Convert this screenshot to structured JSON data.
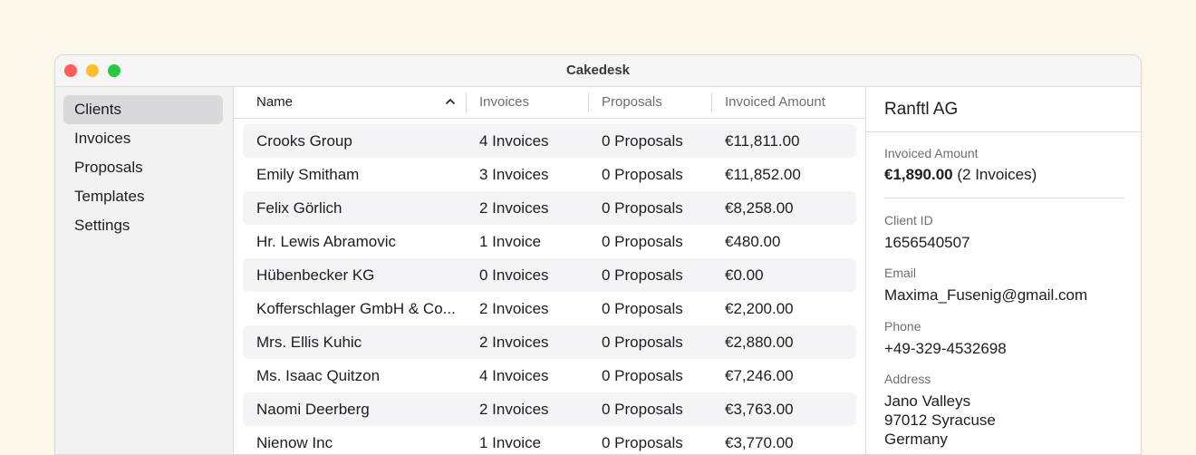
{
  "window": {
    "title": "Cakedesk"
  },
  "sidebar": {
    "items": [
      {
        "label": "Clients",
        "selected": true
      },
      {
        "label": "Invoices",
        "selected": false
      },
      {
        "label": "Proposals",
        "selected": false
      },
      {
        "label": "Templates",
        "selected": false
      },
      {
        "label": "Settings",
        "selected": false
      }
    ]
  },
  "table": {
    "columns": [
      "Name",
      "Invoices",
      "Proposals",
      "Invoiced Amount"
    ],
    "sort_icon": "chevron-up-icon",
    "rows": [
      [
        "Crooks Group",
        "4 Invoices",
        "0 Proposals",
        "€11,811.00"
      ],
      [
        "Emily Smitham",
        "3 Invoices",
        "0 Proposals",
        "€11,852.00"
      ],
      [
        "Felix Görlich",
        "2 Invoices",
        "0 Proposals",
        "€8,258.00"
      ],
      [
        "Hr. Lewis Abramovic",
        "1 Invoice",
        "0 Proposals",
        "€480.00"
      ],
      [
        "Hübenbecker KG",
        "0 Invoices",
        "0 Proposals",
        "€0.00"
      ],
      [
        "Kofferschlager GmbH & Co...",
        "2 Invoices",
        "0 Proposals",
        "€2,200.00"
      ],
      [
        "Mrs. Ellis Kuhic",
        "2 Invoices",
        "0 Proposals",
        "€2,880.00"
      ],
      [
        "Ms. Isaac Quitzon",
        "4 Invoices",
        "0 Proposals",
        "€7,246.00"
      ],
      [
        "Naomi Deerberg",
        "2 Invoices",
        "0 Proposals",
        "€3,763.00"
      ],
      [
        "Nienow Inc",
        "1 Invoice",
        "0 Proposals",
        "€3,770.00"
      ]
    ]
  },
  "detail": {
    "title": "Ranftl AG",
    "invoiced_amount_label": "Invoiced Amount",
    "invoiced_amount_value": "€1,890.00",
    "invoiced_amount_count": " (2 Invoices)",
    "client_id_label": "Client ID",
    "client_id_value": "1656540507",
    "email_label": "Email",
    "email_value": "Maxima_Fusenig@gmail.com",
    "phone_label": "Phone",
    "phone_value": "+49-329-4532698",
    "address_label": "Address",
    "address_lines": [
      "Jano Valleys",
      "97012 Syracuse",
      "Germany"
    ]
  },
  "colors": {
    "background": "#fdf8ec",
    "sidebar_selected": "#d9d9dc",
    "row_alt": "#f4f4f6",
    "traffic_red": "#ff5f57",
    "traffic_yellow": "#febc2e",
    "traffic_green": "#28c840"
  }
}
